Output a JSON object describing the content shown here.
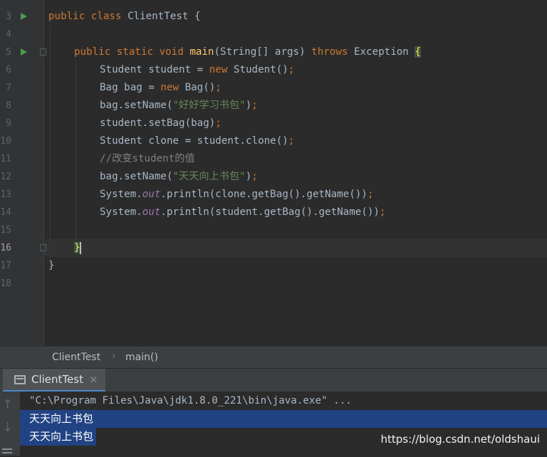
{
  "editor": {
    "line_numbers": [
      "3",
      "4",
      "5",
      "6",
      "7",
      "8",
      "9",
      "10",
      "11",
      "12",
      "13",
      "14",
      "15",
      "16",
      "17",
      "18"
    ],
    "current_line": "16",
    "lines": {
      "l3": {
        "kw1": "public",
        "kw2": "class",
        "name": "ClientTest",
        "brace": "{"
      },
      "l5": {
        "kw1": "public",
        "kw2": "static",
        "kw3": "void",
        "fn": "main",
        "params": "(String[] args)",
        "throws": "throws",
        "exc": "Exception",
        "brace": "{"
      },
      "l6": {
        "a": "Student student = ",
        "kw": "new",
        "b": " Student()",
        "semi": ";"
      },
      "l7": {
        "a": "Bag bag = ",
        "kw": "new",
        "b": " Bag()",
        "semi": ";"
      },
      "l8": {
        "a": "bag.setName(",
        "str": "\"好好学习书包\"",
        "b": ")",
        "semi": ";"
      },
      "l9": {
        "a": "student.setBag(bag)",
        "semi": ";"
      },
      "l10": {
        "a": "Student clone = student.clone()",
        "semi": ";"
      },
      "l11": {
        "cmt": "//改变student的值"
      },
      "l12": {
        "a": "bag.setName(",
        "str": "\"天天向上书包\"",
        "b": ")",
        "semi": ";"
      },
      "l13": {
        "a": "System.",
        "field": "out",
        "b": ".println(clone.getBag().getName())",
        "semi": ";"
      },
      "l14": {
        "a": "System.",
        "field": "out",
        "b": ".println(student.getBag().getName())",
        "semi": ";"
      },
      "l16": {
        "brace": "}"
      },
      "l17": {
        "brace": "}"
      }
    }
  },
  "breadcrumb": {
    "class_name": "ClientTest",
    "separator": "›",
    "method": "main()"
  },
  "run_panel": {
    "tab_label": "ClientTest",
    "tab_close": "×",
    "console": {
      "command": "\"C:\\Program Files\\Java\\jdk1.8.0_221\\bin\\java.exe\" ...",
      "output": [
        "天天向上书包",
        "天天向上书包"
      ]
    },
    "toolbar": {
      "up_icon": "↑",
      "down_icon": "↓"
    }
  },
  "watermark": "https://blog.csdn.net/oldshaui",
  "colors": {
    "background": "#2b2b2b",
    "gutter": "#313335",
    "keyword": "#cc7832",
    "function": "#ffc66d",
    "string": "#6a8759",
    "field": "#9876aa",
    "comment": "#808080",
    "run_icon": "#499c54",
    "selection": "#214283"
  }
}
